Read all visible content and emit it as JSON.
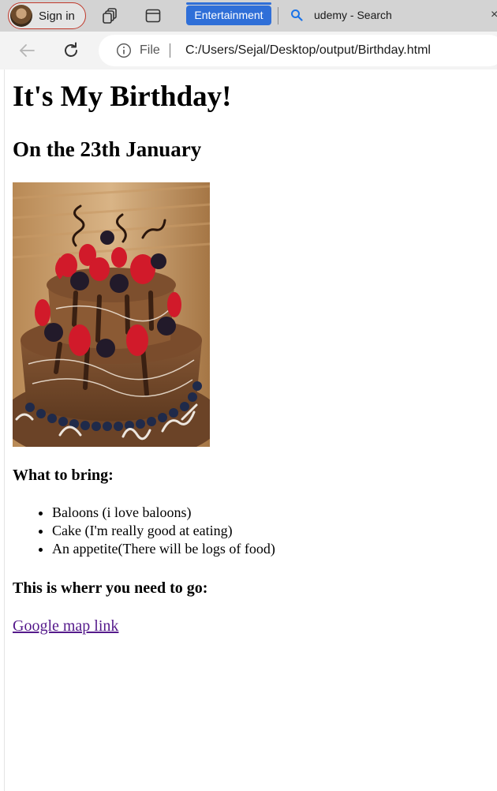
{
  "browser": {
    "profile": {
      "label": "Sign in"
    },
    "tabs": {
      "pinned": "Entertainment",
      "search_tab": "udemy - Search",
      "close": "×"
    },
    "address": {
      "scheme_label": "File",
      "url": "C:/Users/Sejal/Desktop/output/Birthday.html"
    },
    "icons": {
      "workspaces": "workspaces-icon",
      "tab_actions": "tab-actions-icon",
      "search": "search-icon",
      "back": "back-arrow-icon",
      "reload": "reload-icon",
      "info": "info-icon"
    },
    "colors": {
      "tabstrip": "#d3d3d3",
      "toolbar": "#f3f3f3",
      "pinned_tab": "#2f6fd8",
      "profile_border": "#c0392b",
      "visited_link": "#551a8b"
    }
  },
  "page": {
    "title": "It's My Birthday!",
    "subtitle": "On the 23th January",
    "bring_heading": "What to bring:",
    "bring_items": [
      "Baloons (i love baloons)",
      "Cake (I'm really good at eating)",
      "An appetite(There will be logs of food)"
    ],
    "go_heading": "This is wherr you need to go:",
    "map_link": "Google map link"
  }
}
